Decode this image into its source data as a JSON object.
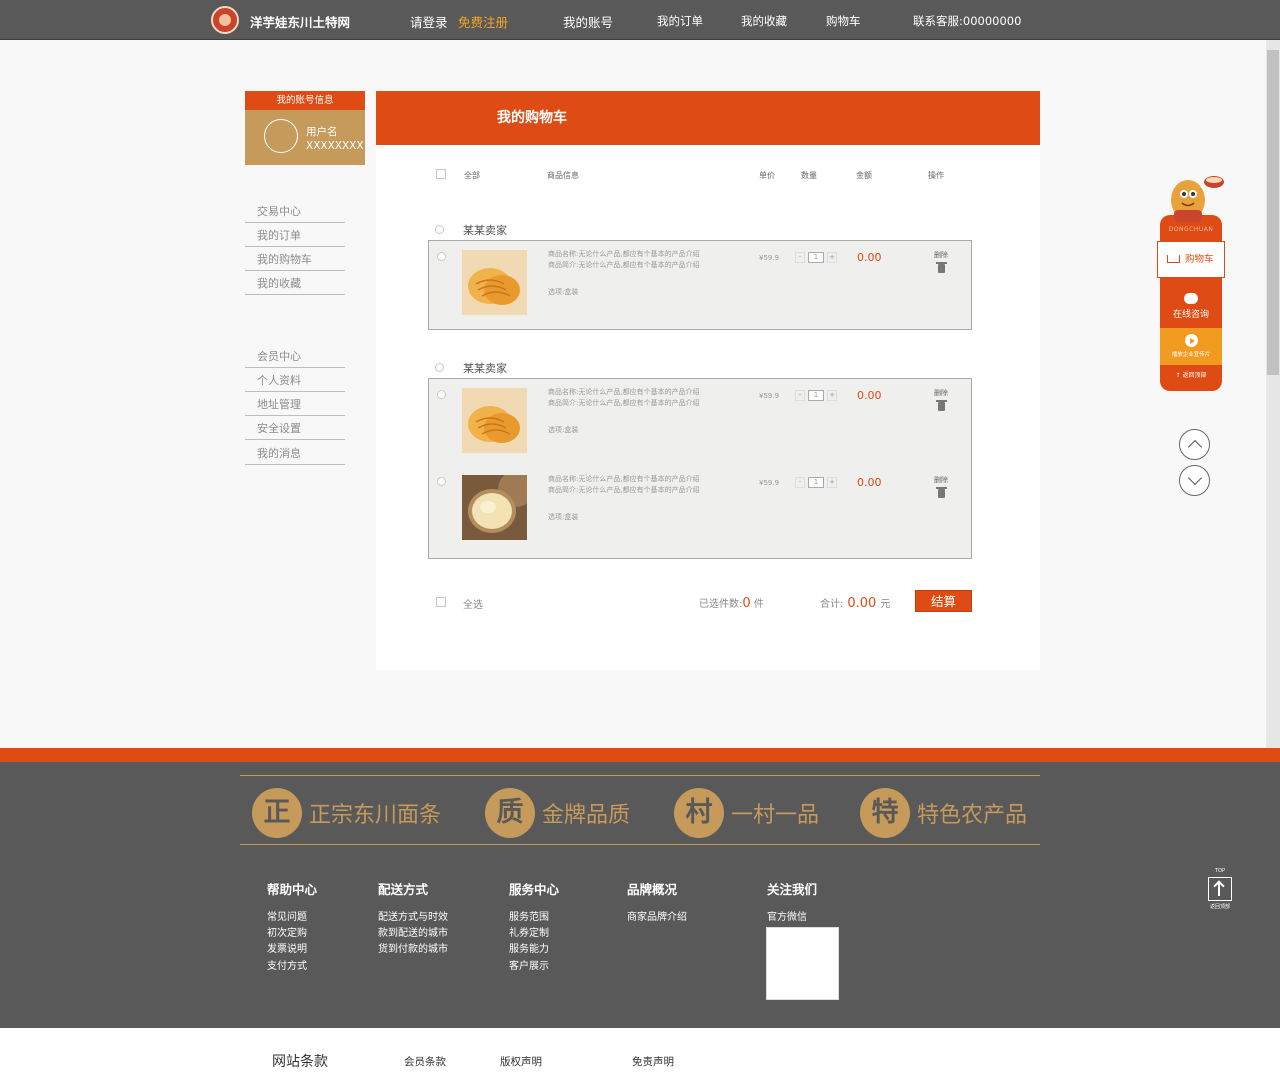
{
  "topnav": {
    "brand": "洋芋娃东川土特网",
    "login": "请登录",
    "register": "免费注册",
    "account": "我的账号",
    "orders": "我的订单",
    "favorites": "我的收藏",
    "cart": "购物车",
    "service": "联系客服:00000000"
  },
  "account_box": {
    "title": "我的账号信息",
    "username_label": "用户名",
    "username_value": "XXXXXXXX"
  },
  "side_menu": {
    "group1": [
      "交易中心",
      "我的订单",
      "我的购物车",
      "我的收藏"
    ],
    "group2": [
      "会员中心",
      "个人资料",
      "地址管理",
      "安全设置",
      "我的消息"
    ]
  },
  "cart": {
    "title": "我的购物车",
    "headers": {
      "all": "全部",
      "info": "商品信息",
      "unit": "单价",
      "qty": "数量",
      "amount": "金额",
      "ops": "操作"
    },
    "sellers": [
      {
        "name": "某某卖家",
        "items": [
          {
            "name_line": "商品名称:无论什么产品,都应有个基本的产品介绍",
            "intro_line": "商品简介:无论什么产品,都应有个基本的产品介绍",
            "option": "选项:盒装",
            "price": "¥59.9",
            "qty_minus": "-",
            "qty": "1",
            "qty_plus": "+",
            "amount": "0.00",
            "delete": "删除"
          }
        ]
      },
      {
        "name": "某某卖家",
        "items": [
          {
            "name_line": "商品名称:无论什么产品,都应有个基本的产品介绍",
            "intro_line": "商品简介:无论什么产品,都应有个基本的产品介绍",
            "option": "选项:盒装",
            "price": "¥59.9",
            "qty_minus": "-",
            "qty": "1",
            "qty_plus": "+",
            "amount": "0.00",
            "delete": "删除"
          },
          {
            "name_line": "商品名称:无论什么产品,都应有个基本的产品介绍",
            "intro_line": "商品简介:无论什么产品,都应有个基本的产品介绍",
            "option": "选项:盒装",
            "price": "¥59.9",
            "qty_minus": "-",
            "qty": "1",
            "qty_plus": "+",
            "amount": "0.00",
            "delete": "删除"
          }
        ]
      }
    ],
    "footer": {
      "select_all": "全选",
      "selected_label": "已选件数:",
      "selected_count": "0",
      "selected_unit": "件",
      "total_label": "合计:",
      "total_value": "0.00",
      "total_unit": "元",
      "checkout": "结算"
    }
  },
  "float_bar": {
    "brand": "DONGCHUAN",
    "cart": "购物车",
    "chat": "在线咨询",
    "video": "播放企业宣传片",
    "top": "返回顶部"
  },
  "footer": {
    "badges": [
      {
        "char": "正",
        "text": "正宗东川面条"
      },
      {
        "char": "质",
        "text": "金牌品质"
      },
      {
        "char": "村",
        "text": "一村一品"
      },
      {
        "char": "特",
        "text": "特色农产品"
      }
    ],
    "columns": [
      {
        "title": "帮助中心",
        "links": [
          "常见问题",
          "初次定购",
          "发票说明",
          "支付方式"
        ]
      },
      {
        "title": "配送方式",
        "links": [
          "配送方式与时效",
          "款到配送的城市",
          "货到付款的城市"
        ]
      },
      {
        "title": "服务中心",
        "links": [
          "服务范围",
          "礼券定制",
          "服务能力",
          "客户展示"
        ]
      },
      {
        "title": "品牌概况",
        "links": [
          "商家品牌介绍"
        ]
      },
      {
        "title": "关注我们",
        "links": [
          "官方微信"
        ]
      }
    ],
    "totop_en": "TOP",
    "totop_cn": "返回顶部"
  },
  "bottom_links": [
    "网站条款",
    "会员条款",
    "版权声明",
    "免责声明"
  ],
  "colors": {
    "accent": "#de4b14",
    "gold": "#c59a5b",
    "dark": "#595959"
  }
}
